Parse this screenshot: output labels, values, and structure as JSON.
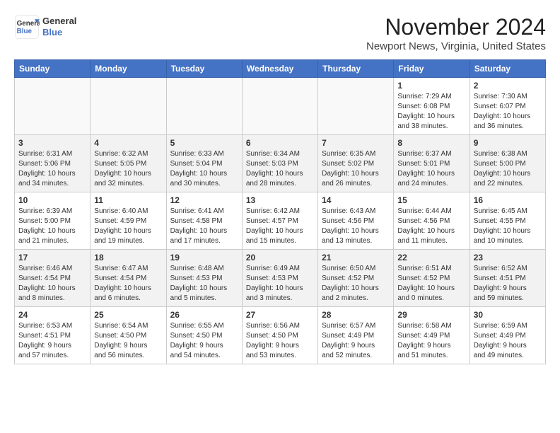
{
  "header": {
    "logo_line1": "General",
    "logo_line2": "Blue",
    "month_title": "November 2024",
    "location": "Newport News, Virginia, United States"
  },
  "weekdays": [
    "Sunday",
    "Monday",
    "Tuesday",
    "Wednesday",
    "Thursday",
    "Friday",
    "Saturday"
  ],
  "weeks": [
    [
      {
        "day": "",
        "info": ""
      },
      {
        "day": "",
        "info": ""
      },
      {
        "day": "",
        "info": ""
      },
      {
        "day": "",
        "info": ""
      },
      {
        "day": "",
        "info": ""
      },
      {
        "day": "1",
        "info": "Sunrise: 7:29 AM\nSunset: 6:08 PM\nDaylight: 10 hours\nand 38 minutes."
      },
      {
        "day": "2",
        "info": "Sunrise: 7:30 AM\nSunset: 6:07 PM\nDaylight: 10 hours\nand 36 minutes."
      }
    ],
    [
      {
        "day": "3",
        "info": "Sunrise: 6:31 AM\nSunset: 5:06 PM\nDaylight: 10 hours\nand 34 minutes."
      },
      {
        "day": "4",
        "info": "Sunrise: 6:32 AM\nSunset: 5:05 PM\nDaylight: 10 hours\nand 32 minutes."
      },
      {
        "day": "5",
        "info": "Sunrise: 6:33 AM\nSunset: 5:04 PM\nDaylight: 10 hours\nand 30 minutes."
      },
      {
        "day": "6",
        "info": "Sunrise: 6:34 AM\nSunset: 5:03 PM\nDaylight: 10 hours\nand 28 minutes."
      },
      {
        "day": "7",
        "info": "Sunrise: 6:35 AM\nSunset: 5:02 PM\nDaylight: 10 hours\nand 26 minutes."
      },
      {
        "day": "8",
        "info": "Sunrise: 6:37 AM\nSunset: 5:01 PM\nDaylight: 10 hours\nand 24 minutes."
      },
      {
        "day": "9",
        "info": "Sunrise: 6:38 AM\nSunset: 5:00 PM\nDaylight: 10 hours\nand 22 minutes."
      }
    ],
    [
      {
        "day": "10",
        "info": "Sunrise: 6:39 AM\nSunset: 5:00 PM\nDaylight: 10 hours\nand 21 minutes."
      },
      {
        "day": "11",
        "info": "Sunrise: 6:40 AM\nSunset: 4:59 PM\nDaylight: 10 hours\nand 19 minutes."
      },
      {
        "day": "12",
        "info": "Sunrise: 6:41 AM\nSunset: 4:58 PM\nDaylight: 10 hours\nand 17 minutes."
      },
      {
        "day": "13",
        "info": "Sunrise: 6:42 AM\nSunset: 4:57 PM\nDaylight: 10 hours\nand 15 minutes."
      },
      {
        "day": "14",
        "info": "Sunrise: 6:43 AM\nSunset: 4:56 PM\nDaylight: 10 hours\nand 13 minutes."
      },
      {
        "day": "15",
        "info": "Sunrise: 6:44 AM\nSunset: 4:56 PM\nDaylight: 10 hours\nand 11 minutes."
      },
      {
        "day": "16",
        "info": "Sunrise: 6:45 AM\nSunset: 4:55 PM\nDaylight: 10 hours\nand 10 minutes."
      }
    ],
    [
      {
        "day": "17",
        "info": "Sunrise: 6:46 AM\nSunset: 4:54 PM\nDaylight: 10 hours\nand 8 minutes."
      },
      {
        "day": "18",
        "info": "Sunrise: 6:47 AM\nSunset: 4:54 PM\nDaylight: 10 hours\nand 6 minutes."
      },
      {
        "day": "19",
        "info": "Sunrise: 6:48 AM\nSunset: 4:53 PM\nDaylight: 10 hours\nand 5 minutes."
      },
      {
        "day": "20",
        "info": "Sunrise: 6:49 AM\nSunset: 4:53 PM\nDaylight: 10 hours\nand 3 minutes."
      },
      {
        "day": "21",
        "info": "Sunrise: 6:50 AM\nSunset: 4:52 PM\nDaylight: 10 hours\nand 2 minutes."
      },
      {
        "day": "22",
        "info": "Sunrise: 6:51 AM\nSunset: 4:52 PM\nDaylight: 10 hours\nand 0 minutes."
      },
      {
        "day": "23",
        "info": "Sunrise: 6:52 AM\nSunset: 4:51 PM\nDaylight: 9 hours\nand 59 minutes."
      }
    ],
    [
      {
        "day": "24",
        "info": "Sunrise: 6:53 AM\nSunset: 4:51 PM\nDaylight: 9 hours\nand 57 minutes."
      },
      {
        "day": "25",
        "info": "Sunrise: 6:54 AM\nSunset: 4:50 PM\nDaylight: 9 hours\nand 56 minutes."
      },
      {
        "day": "26",
        "info": "Sunrise: 6:55 AM\nSunset: 4:50 PM\nDaylight: 9 hours\nand 54 minutes."
      },
      {
        "day": "27",
        "info": "Sunrise: 6:56 AM\nSunset: 4:50 PM\nDaylight: 9 hours\nand 53 minutes."
      },
      {
        "day": "28",
        "info": "Sunrise: 6:57 AM\nSunset: 4:49 PM\nDaylight: 9 hours\nand 52 minutes."
      },
      {
        "day": "29",
        "info": "Sunrise: 6:58 AM\nSunset: 4:49 PM\nDaylight: 9 hours\nand 51 minutes."
      },
      {
        "day": "30",
        "info": "Sunrise: 6:59 AM\nSunset: 4:49 PM\nDaylight: 9 hours\nand 49 minutes."
      }
    ]
  ]
}
